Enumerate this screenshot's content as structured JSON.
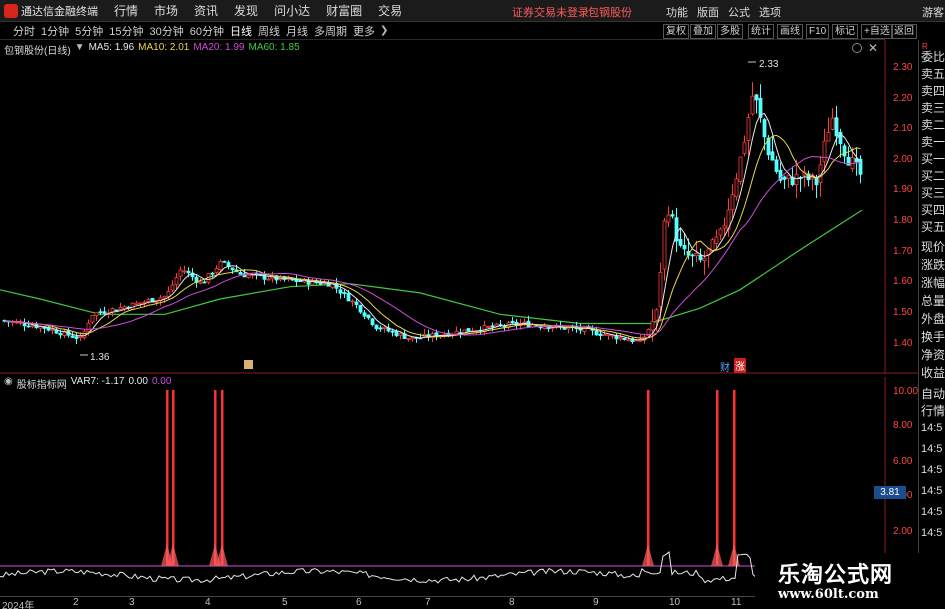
{
  "titlebar": {
    "app_title": "通达信金融终端",
    "menus": [
      "行情",
      "市场",
      "资讯",
      "发现",
      "问小达",
      "财富圈",
      "交易"
    ],
    "login_warning": "证券交易未登录",
    "stock_name": "包钢股份",
    "right_menus": [
      "功能",
      "版面",
      "公式",
      "选项"
    ],
    "guest": "游客"
  },
  "period_bar": {
    "items": [
      "分时",
      "1分钟",
      "5分钟",
      "15分钟",
      "30分钟",
      "60分钟",
      "日线",
      "周线",
      "月线",
      "多周期",
      "更多"
    ],
    "active": "日线"
  },
  "tool_buttons": [
    "复权",
    "叠加",
    "多股",
    "统计",
    "画线",
    "F10",
    "标记",
    "+自选",
    "返回"
  ],
  "main_chart": {
    "stock_label": "包钢股份(日线)",
    "ma5": "MA5: 1.96",
    "ma10": "MA10: 2.01",
    "ma20": "MA20: 1.99",
    "ma60": "MA60: 1.85",
    "high_label": "2.33",
    "low_label": "1.36",
    "price_ticks": [
      "2.30",
      "2.20",
      "2.10",
      "2.00",
      "1.90",
      "1.80",
      "1.70",
      "1.60",
      "1.50",
      "1.40"
    ],
    "tag_cai": "财",
    "tag_zhang": "涨"
  },
  "side_panel": {
    "corner": "R",
    "items": [
      "委比",
      "卖五",
      "卖四",
      "卖三",
      "卖二",
      "卖一",
      "买一",
      "买二",
      "买三",
      "买四",
      "买五",
      "现价",
      "涨跌",
      "涨幅",
      "总量",
      "外盘",
      "换手",
      "净资",
      "收益"
    ],
    "lower_items": [
      "自动",
      "行情"
    ],
    "times": [
      "14:5",
      "14:5",
      "14:5",
      "14:5",
      "14:5",
      "14:5"
    ]
  },
  "sub_chart": {
    "name": "股标指标网",
    "var": "VAR7: -1.17",
    "val1": "0.00",
    "val2": "0.00",
    "ticks": [
      "10.00",
      "8.00",
      "6.00",
      "4.00",
      "2.00"
    ],
    "current_value": "3.81"
  },
  "date_axis": {
    "labels": [
      "2024年",
      "2",
      "3",
      "4",
      "5",
      "6",
      "7",
      "8",
      "9",
      "10",
      "11"
    ]
  },
  "watermark": {
    "title": "乐淘公式网",
    "url": "www.60lt.com"
  },
  "colors": {
    "up": "#ff3b3b",
    "down": "#54ffff",
    "ma5": "#e8e8e8",
    "ma10": "#e8d84a",
    "ma20": "#d04bd8",
    "ma60": "#40c840",
    "sub_line": "#e8e8e8",
    "sub_signal": "#ff3030",
    "baseline": "#d04bd8"
  }
}
